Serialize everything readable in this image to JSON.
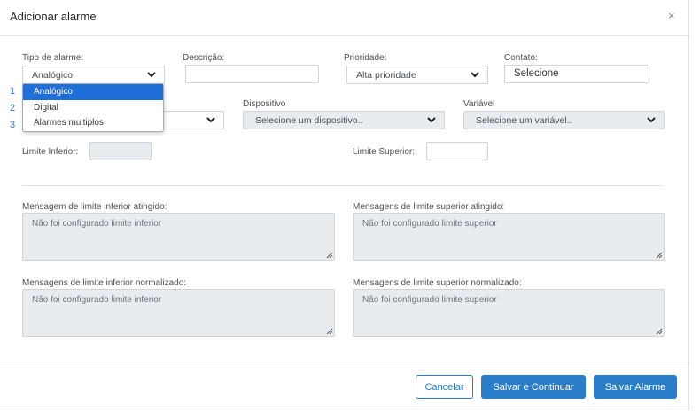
{
  "modal": {
    "title": "Adicionar alarme",
    "close_glyph": "×"
  },
  "form": {
    "tipo": {
      "label": "Tipo de alarme:",
      "value": "Analógico"
    },
    "descricao": {
      "label": "Descrição:",
      "value": ""
    },
    "prioridade": {
      "label": "Prioridade:",
      "value": "Alta prioridade"
    },
    "contato": {
      "label": "Contato:",
      "value": "Selecione"
    },
    "dispositivo": {
      "label": "Dispositivo",
      "value": "Selecione um dispositivo.."
    },
    "variavel": {
      "label": "Variável",
      "value": "Selecione um variável.."
    },
    "limite_inferior": {
      "label": "Limite Inferior:",
      "value": ""
    },
    "limite_superior": {
      "label": "Limite Superior:",
      "value": ""
    }
  },
  "dropdown": {
    "options": [
      "Analógico",
      "Digital",
      "Alarmes multiplos"
    ],
    "selected_index": 0,
    "numbers": [
      "1",
      "2",
      "3"
    ]
  },
  "messages": {
    "inferior_atingido": {
      "label": "Mensagem de limite inferior atingido:",
      "value": "Não foi configurado limite inferior"
    },
    "superior_atingido": {
      "label": "Mensagens de limite superior atingido:",
      "value": "Não foi configurado limite superior"
    },
    "inferior_normalizado": {
      "label": "Mensagens de limite inferior normalizado:",
      "value": "Não foi configurado limite inferior"
    },
    "superior_normalizado": {
      "label": "Mensagens de limite superior normalizado:",
      "value": "Não foi configurado limite superior"
    }
  },
  "footer": {
    "cancel_label": "Cancelar",
    "save_continue_label": "Salvar e Continuar",
    "save_label": "Salvar Alarme"
  },
  "colors": {
    "primary": "#2a7dc9",
    "dropdown_selected": "#1e6fd9",
    "disabled_bg": "#e9ecef"
  }
}
